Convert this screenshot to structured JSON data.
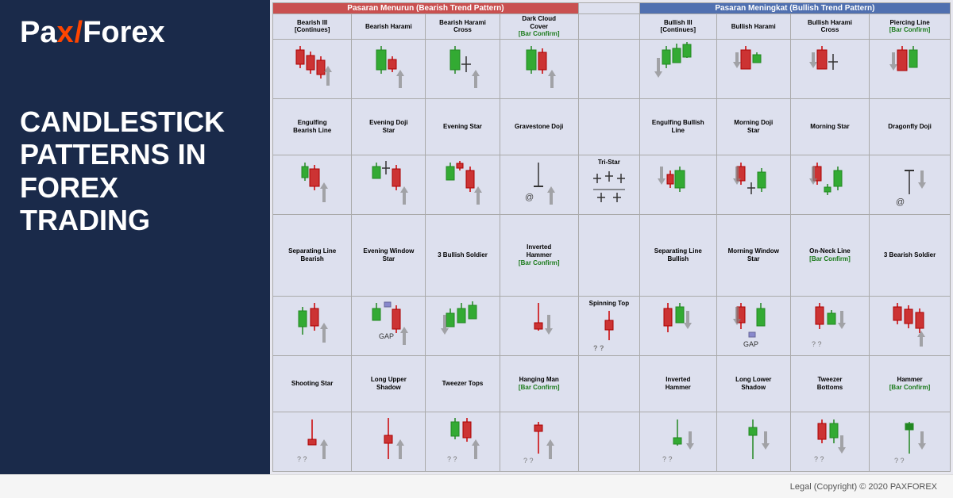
{
  "logo": {
    "pax": "Pax",
    "slash": "/",
    "forex": "Forex",
    "orange_x": "x"
  },
  "title": {
    "line1": "CANDLESTICK",
    "line2": "PATTERNS IN",
    "line3": "FOREX TRADING"
  },
  "bearish_header": "Pasaran Menurun (Bearish Trend Pattern)",
  "bullish_header": "Pasaran Meningkat (Bullish Trend Pattern)",
  "bearish_columns": [
    "Bearish III\n[Continues]",
    "Bearish Harami",
    "Bearish Harami\nCross",
    "Dark Cloud\nCover\n[Bar Confirm]"
  ],
  "bullish_columns": [
    "Bullish III\n[Continues]",
    "Bullish Harami",
    "Bullish Harami\nCross",
    "Piercing Line\n[Bar Confirm]"
  ],
  "bearish_row2": [
    "Engulfing\nBearish Line",
    "Evening Doji\nStar",
    "Evening Star",
    "Gravestone Doji"
  ],
  "bullish_row2": [
    "Engulfing Bullish\nLine",
    "Morning Doji\nStar",
    "Morning Star",
    "Dragonfly Doji"
  ],
  "center_row2": "Tri-Star",
  "bearish_row3": [
    "Separating Line\nBearish",
    "Evening Window\nStar",
    "3 Bullish Soldier",
    "Inverted\nHammer\n[Bar Confirm]"
  ],
  "bullish_row3": [
    "Separating Line\nBullish",
    "Morning Window\nStar",
    "On-Neck Line\n[Bar Confirm]",
    "3 Bearish Soldier"
  ],
  "center_row3": "Spinning Top",
  "bearish_row4": [
    "Shooting Star",
    "Long Upper\nShadow",
    "Tweezer Tops",
    "Hanging Man\n[Bar Confirm]"
  ],
  "bullish_row4": [
    "Inverted\nHammer",
    "Long Lower\nShadow",
    "Tweezer\nBottoms",
    "Hammer\n[Bar Confirm]"
  ],
  "footer": {
    "text": "Legal (Copyright) © 2020 PAXFOREX"
  }
}
